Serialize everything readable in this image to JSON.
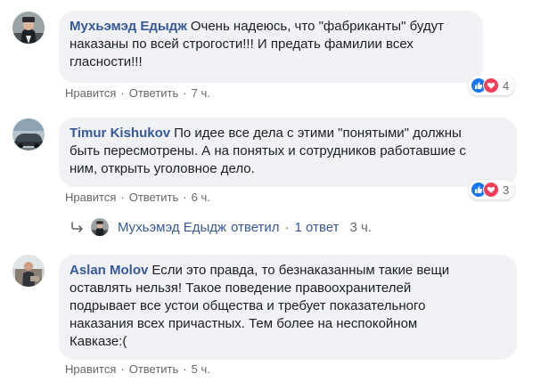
{
  "comments": [
    {
      "author": "Мухьэмэд Едыдж",
      "lines": [
        "Очень надеюсь, что \"фабриканты\" будут",
        "наказаны по всей строгости!!! И предать фамилии всех",
        "гласности!!!"
      ],
      "like_label": "Нравится",
      "reply_label": "Ответить",
      "time": "7 ч.",
      "reaction_count": "4"
    },
    {
      "author": "Timur Kishukov",
      "lines": [
        "По идее все дела с этими \"понятыми\" должны",
        "быть пересмотрены. А на понятых и сотрудников работавшие с",
        "ним, открыть уголовное дело."
      ],
      "like_label": "Нравится",
      "reply_label": "Ответить",
      "time": "6 ч.",
      "reaction_count": "3",
      "reply_summary": {
        "author": "Мухьэмэд Едыдж",
        "verb": "ответил",
        "count": "1 ответ",
        "time": "3 ч."
      }
    },
    {
      "author": "Aslan Molov",
      "lines": [
        "Если это правда, то безнаказанным такие вещи",
        "оставлять нельзя! Такое поведение правоохранителей",
        "подрывает все устои общества и требует показательного",
        "наказания всех причастных. Тем более на неспокойном",
        "Кавказе:("
      ],
      "like_label": "Нравится",
      "reply_label": "Ответить",
      "time": "5 ч."
    }
  ],
  "separator": "·",
  "colors": {
    "bubble": "#f0f2f5",
    "author": "#385898",
    "meta": "#65676b",
    "like": "#1877f2",
    "love": "#f33e58"
  }
}
